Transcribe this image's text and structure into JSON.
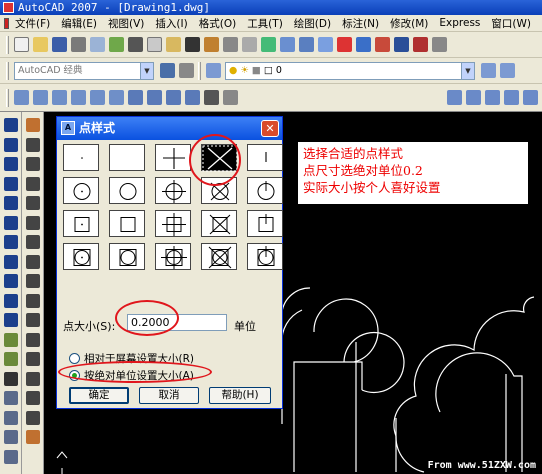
{
  "window": {
    "title": "AutoCAD 2007 - [Drawing1.dwg]"
  },
  "menu": [
    "文件(F)",
    "编辑(E)",
    "视图(V)",
    "插入(I)",
    "格式(O)",
    "工具(T)",
    "绘图(D)",
    "标注(N)",
    "修改(M)",
    "Express",
    "窗口(W)"
  ],
  "workspace": {
    "value": "AutoCAD 经典"
  },
  "layer": {
    "value": "0"
  },
  "dialog": {
    "title": "点样式",
    "size_label": "点大小(S):",
    "size_value": "0.2000",
    "unit_label": "单位",
    "radio_relative": "相对于屏幕设置大小(R)",
    "radio_absolute": "按绝对单位设置大小(A)",
    "ok_label": "确定",
    "cancel_label": "取消",
    "help_label": "帮助(H)",
    "selected_style_index": 3
  },
  "annotation": {
    "lines": [
      "选择合适的点样式",
      "点尺寸选绝对单位0.2",
      "实际大小按个人喜好设置"
    ]
  },
  "watermark": "From www.51ZXW.com",
  "colors": {
    "highlight": "#e0161c",
    "annotation_text": "#e00000",
    "titlebar": "#0a3fb8"
  }
}
